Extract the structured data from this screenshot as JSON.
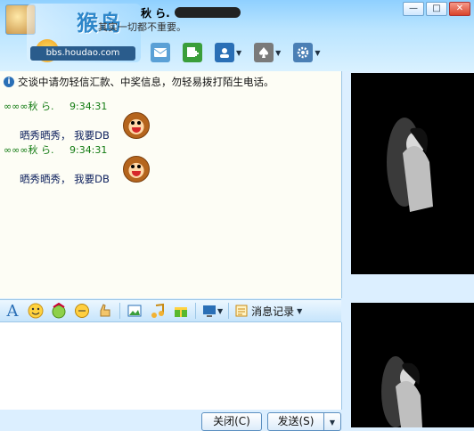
{
  "header": {
    "contact_name": "秋 ら.",
    "signature": "其实一切都不重要。",
    "watermark_logo": "猴岛",
    "watermark_url": "bbs.houdao.com",
    "window_buttons": [
      "—",
      "□",
      "✕"
    ]
  },
  "top_toolbar": {
    "items": [
      {
        "name": "message-icon",
        "color": "#5aa0d6"
      },
      {
        "name": "add-icon",
        "color": "#3a9e3a"
      },
      {
        "name": "contact-card-icon",
        "color": "#2a6fb6"
      },
      {
        "name": "games-icon",
        "color": "#7a7a7a"
      },
      {
        "name": "settings-icon",
        "color": "#4a7fb5"
      }
    ]
  },
  "chat": {
    "notice": "交谈中请勿轻信汇款、中奖信息，勿轻易拨打陌生电话。",
    "messages": [
      {
        "sender": "∞∞∞秋 ら.",
        "time": "9:34:31",
        "text": "晒秀晒秀， 我要DB"
      },
      {
        "sender": "∞∞∞秋 ら.",
        "time": "9:34:31",
        "text": "晒秀晒秀， 我要DB"
      }
    ]
  },
  "format_toolbar": {
    "font_icon_label": "A",
    "history_label": "消息记录"
  },
  "buttons": {
    "close_label": "关闭(C)",
    "send_label": "发送(S)"
  },
  "colors": {
    "accent": "#8fd0ff",
    "chat_bg": "#fdfdf5",
    "sender": "#117a11",
    "message": "#0c1f5c"
  }
}
